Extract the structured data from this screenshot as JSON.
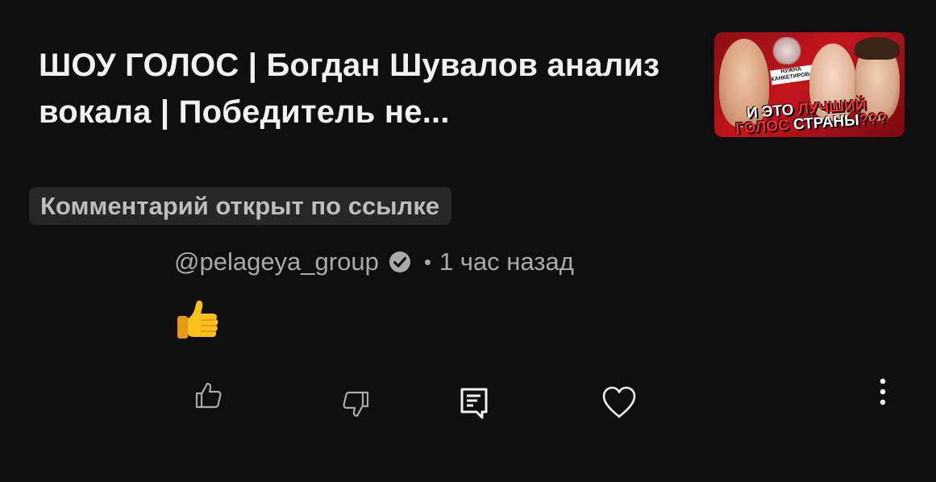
{
  "video": {
    "title": "ШОУ ГОЛОС | Богдан Шувалов анализ вокала | Победитель не...",
    "thumbnail": {
      "small_text": "НУЖНА КАНКЕТИРОВАТЬ",
      "headline_line1_white": "И ЭТО ",
      "headline_line1_red": "ЛУЧШИЙ",
      "headline_line2_red": "ГОЛОС ",
      "headline_line2_white": "СТРАНЫ",
      "headline_line2_suffix": "???"
    }
  },
  "linked_comment": {
    "label": "Комментарий открыт по ссылке"
  },
  "comment": {
    "author": "@pelageya_group",
    "separator": "•",
    "time": "1 час назад",
    "verified": true,
    "body_emoji": "thumbs-up"
  },
  "actions": {
    "like_icon": "thumbs-up-outline-icon",
    "dislike_icon": "thumbs-down-outline-icon",
    "reply_icon": "comment-reply-icon",
    "heart_icon": "heart-outline-icon",
    "more_icon": "more-vertical-icon"
  },
  "colors": {
    "background": "#0f0f0f",
    "chip_background": "#272727",
    "secondary_text": "#aaaaaa",
    "primary_text": "#f1f1f1"
  }
}
